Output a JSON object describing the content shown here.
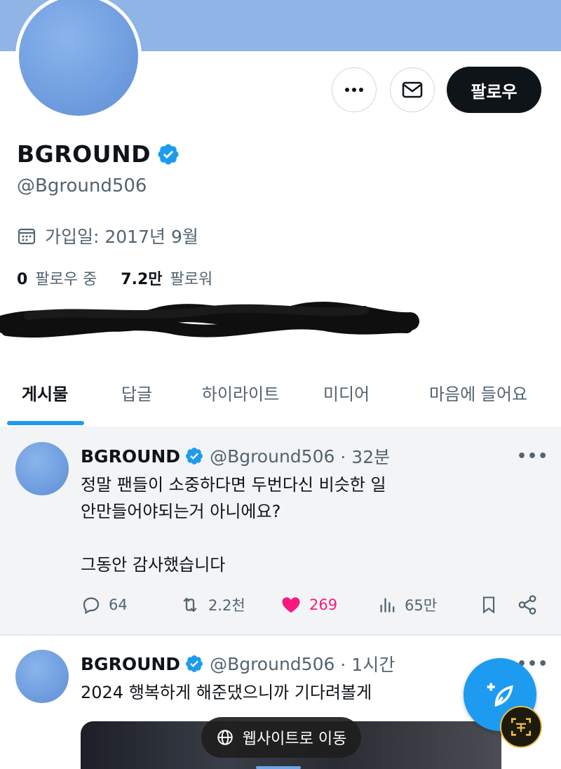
{
  "profile": {
    "display_name": "BGROUND",
    "handle": "@Bground506",
    "joined": "가입일: 2017년 9월",
    "following_count": "0",
    "following_label": "팔로우 중",
    "followers_count": "7.2만",
    "followers_label": "팔로워",
    "follow_button": "팔로우"
  },
  "tabs": [
    {
      "label": "게시물",
      "active": true
    },
    {
      "label": "답글"
    },
    {
      "label": "하이라이트"
    },
    {
      "label": "미디어"
    },
    {
      "label": "마음에 들어요"
    }
  ],
  "tweets": [
    {
      "name": "BGROUND",
      "handle": "@Bground506",
      "time": "· 32분",
      "text_lines": [
        "정말 팬들이 소중하다면 두번다신 비슷한 일",
        "안만들어야되는거 아니에요?",
        "",
        "그동안 감사했습니다"
      ],
      "replies": "64",
      "retweets": "2.2천",
      "likes": "269",
      "views": "65만"
    },
    {
      "name": "BGROUND",
      "handle": "@Bground506",
      "time": "· 1시간",
      "text_lines": [
        "2024 행복하게 해준댔으니까 기다려볼게"
      ]
    }
  ],
  "overlay": {
    "website_pill": "웹사이트로 이동"
  },
  "colors": {
    "accent": "#1d9bf0",
    "like": "#f91880",
    "banner": "#8fb4e6"
  },
  "icons": [
    "more-icon",
    "mail-icon",
    "verified-icon",
    "calendar-icon",
    "reply-icon",
    "retweet-icon",
    "heart-icon",
    "views-icon",
    "bookmark-icon",
    "share-icon",
    "compose-icon",
    "globe-icon"
  ]
}
